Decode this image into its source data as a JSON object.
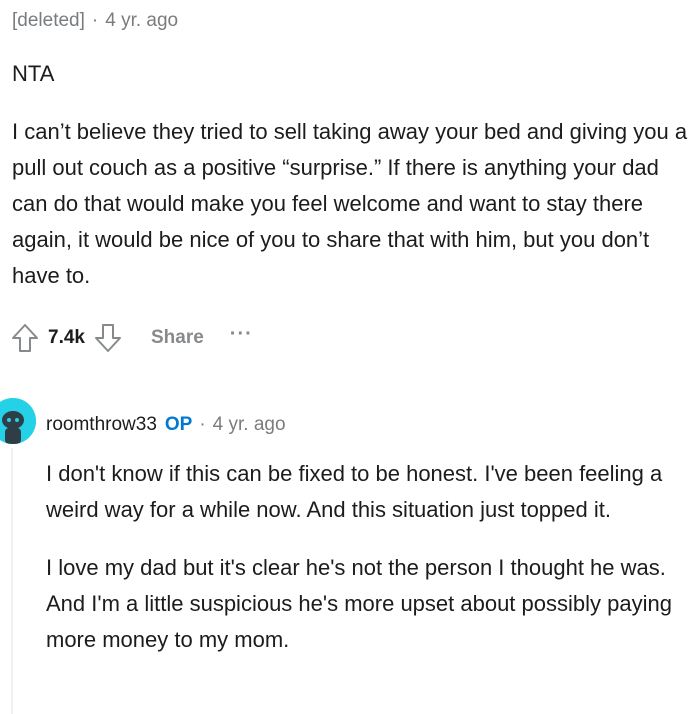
{
  "comment1": {
    "author": "[deleted]",
    "separator": "·",
    "time": "4 yr. ago",
    "paragraphs": [
      "NTA",
      "I can’t believe they tried to sell taking away your bed and giving you a pull out couch as a positive “surprise.” If there is anything your dad can do that would make you feel welcome and want to stay there again, it would be nice of you to share that with him, but you don’t have to."
    ],
    "score": "7.4k",
    "share_label": "Share",
    "more_label": "···",
    "icons": [
      "upvote-icon",
      "downvote-icon",
      "more-options-icon"
    ]
  },
  "comment2": {
    "author": "roomthrow33",
    "badge": "OP",
    "separator": "·",
    "time": "4 yr. ago",
    "paragraphs": [
      "I don't know if this can be fixed to be honest. I've been feeling a weird way for a while now. And this situation just topped it.",
      "I love my dad but it's clear he's not the person I thought he was. And I'm a little suspicious he's more upset about possibly paying more money to my mom."
    ],
    "icons": [
      "avatar-icon"
    ]
  },
  "colors": {
    "text": "#1c1c1c",
    "meta": "#7c7c7c",
    "op_badge": "#0079d3",
    "avatar_bg": "#24d1e6",
    "action_gray": "#878a8c"
  }
}
